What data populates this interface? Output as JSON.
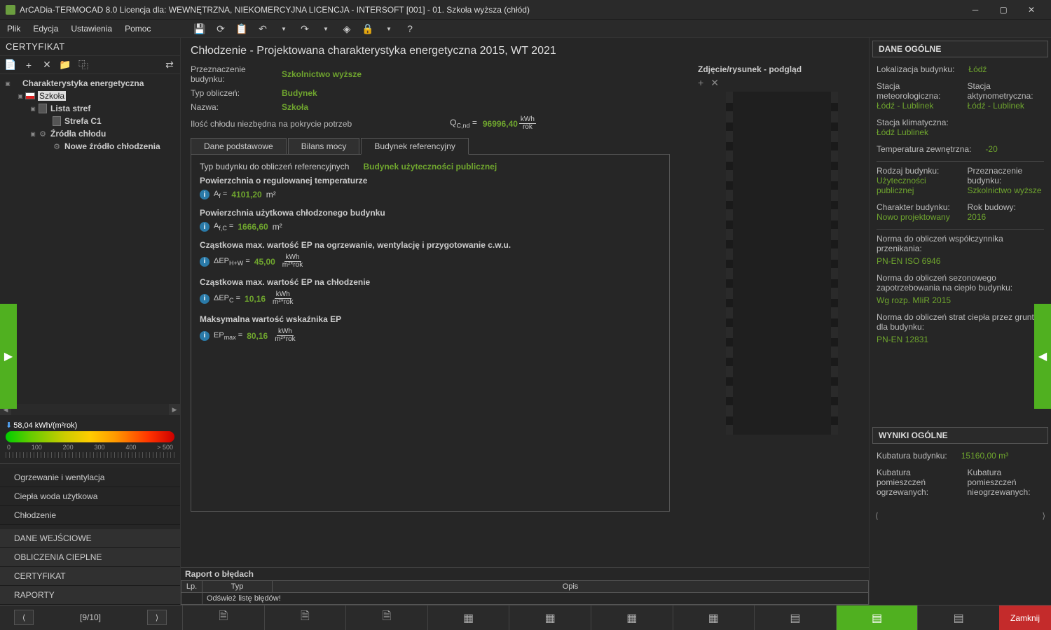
{
  "titlebar": {
    "title": "ArCADia-TERMOCAD 8.0 Licencja dla: WEWNĘTRZNA, NIEKOMERCYJNA LICENCJA - INTERSOFT [001] - 01. Szkoła wyższa (chłód)"
  },
  "menu": {
    "file": "Plik",
    "edit": "Edycja",
    "settings": "Ustawienia",
    "help": "Pomoc"
  },
  "leftPanel": {
    "header": "CERTYFIKAT",
    "tree": {
      "root": "Charakterystyka energetyczna",
      "school": "Szkoła",
      "zoneList": "Lista stref",
      "zoneC1": "Strefa C1",
      "coldSources": "Źródła chłodu",
      "newCold": "Nowe źródło chłodzenia"
    },
    "energyValue": "58,04 kWh/(m²rok)",
    "scale": [
      "0",
      "100",
      "200",
      "300",
      "400",
      "> 500"
    ],
    "bottomList": {
      "heating": "Ogrzewanie i wentylacja",
      "dhw": "Ciepła woda użytkowa",
      "cooling": "Chłodzenie",
      "inputData": "DANE WEJŚCIOWE",
      "thermalCalc": "OBLICZENIA CIEPLNE",
      "cert": "CERTYFIKAT",
      "reports": "RAPORTY"
    }
  },
  "content": {
    "title": "Chłodzenie - Projektowana charakterystyka energetyczna 2015, WT 2021",
    "purpose_label": "Przeznaczenie budynku:",
    "purpose_value": "Szkolnictwo wyższe",
    "calcType_label": "Typ obliczeń:",
    "calcType_value": "Budynek",
    "name_label": "Nazwa:",
    "name_value": "Szkoła",
    "cold_label": "Ilość chłodu niezbędna na pokrycie potrzeb",
    "cold_symbol": "Q",
    "cold_sub": "C,nd",
    "cold_value": "96996,40",
    "cold_unit_top": "kWh",
    "cold_unit_bot": "rok",
    "tabs": {
      "basic": "Dane podstawowe",
      "power": "Bilans mocy",
      "ref": "Budynek referencyjny"
    },
    "ref": {
      "type_label": "Typ budynku do obliczeń referencyjnych",
      "type_value": "Budynek użyteczności publicznej",
      "af_label": "Powierzchnia o regulowanej temperaturze",
      "af_symbol": "A",
      "af_sub": "f",
      "af_value": "4101,20",
      "af_unit": "m²",
      "afc_label": "Powierzchnia użytkowa chłodzonego budynku",
      "afc_symbol": "A",
      "afc_sub": "f,C",
      "afc_value": "1666,60",
      "afc_unit": "m²",
      "ephw_label": "Cząstkowa max. wartość EP na ogrzewanie, wentylację i przygotowanie c.w.u.",
      "ephw_symbol": "ΔEP",
      "ephw_sub": "H+W",
      "ephw_value": "45,00",
      "epc_label": "Cząstkowa max. wartość EP na chłodzenie",
      "epc_symbol": "ΔEP",
      "epc_sub": "C",
      "epc_value": "10,16",
      "epmax_label": "Maksymalna wartość wskaźnika EP",
      "epmax_symbol": "EP",
      "epmax_sub": "max",
      "epmax_value": "80,16",
      "frac_top": "kWh",
      "frac_bot": "m²*rok"
    }
  },
  "imagePanel": {
    "header": "Zdjęcie/rysunek - podgląd"
  },
  "rightPanel": {
    "generalDataHeader": "DANE OGÓLNE",
    "loc_label": "Lokalizacja budynku:",
    "loc_value": "Łódź",
    "meteo_label": "Stacja meteorologiczna:",
    "meteo_value": "Łódź - Lublinek",
    "actino_label": "Stacja aktynometryczna:",
    "actino_value": "Łódź - Lublinek",
    "climate_label": "Stacja klimatyczna:",
    "climate_value": "Łódź Lublinek",
    "temp_label": "Temperatura zewnętrzna:",
    "temp_value": "-20",
    "btype_label": "Rodzaj budynku:",
    "btype_value": "Użyteczności publicznej",
    "purpose_label": "Przeznaczenie budynku:",
    "purpose_value": "Szkolnictwo wyższe",
    "char_label": "Charakter budynku:",
    "char_value": "Nowo projektowany",
    "year_label": "Rok budowy:",
    "year_value": "2016",
    "norm1_label": "Norma do obliczeń współczynnika przenikania:",
    "norm1_value": "PN-EN ISO 6946",
    "norm2_label": "Norma do obliczeń sezonowego zapotrzebowania na ciepło budynku:",
    "norm2_value": "Wg rozp. MIiR 2015",
    "norm3_label": "Norma do obliczeń strat ciepła przez grunt dla budynku:",
    "norm3_value": "PN-EN 12831",
    "resultsHeader": "WYNIKI OGÓLNE",
    "volume_label": "Kubatura budynku:",
    "volume_value": "15160,00 m³",
    "heatedVol_label": "Kubatura pomieszczeń ogrzewanych:",
    "unheatedVol_label": "Kubatura pomieszczeń nieogrzewanych:"
  },
  "errorPanel": {
    "title": "Raport o błędach",
    "col_lp": "Lp.",
    "col_type": "Typ",
    "col_desc": "Opis",
    "refresh": "Odśwież listę błędów!"
  },
  "bottomBar": {
    "close": "Zamknij",
    "pageIndicator": "[9/10]"
  }
}
